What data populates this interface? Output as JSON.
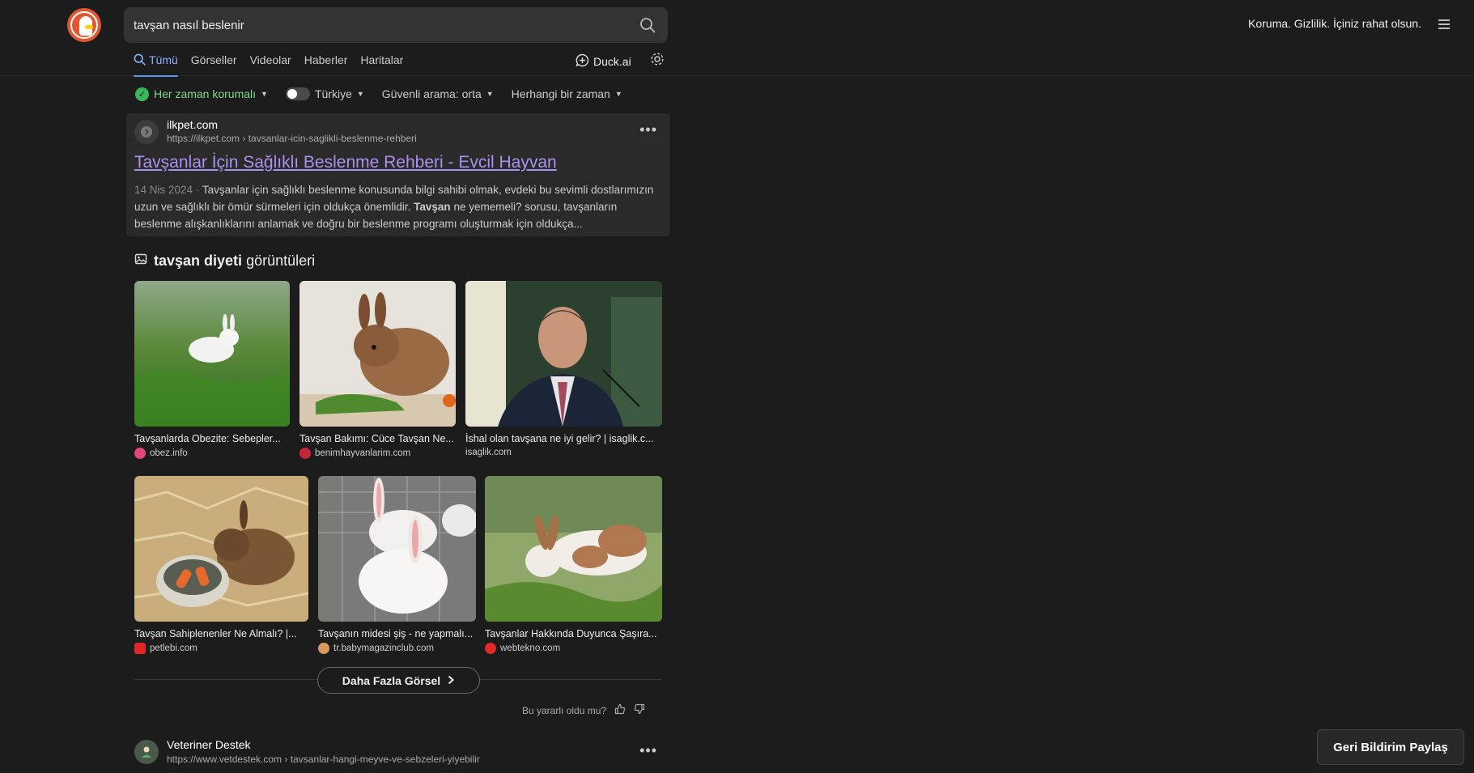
{
  "search": {
    "query": "tavşan nasıl beslenir"
  },
  "header": {
    "tagline": "Koruma. Gizlilik. İçiniz rahat olsun."
  },
  "tabs": [
    {
      "label": "Tümü",
      "active": true
    },
    {
      "label": "Görseller"
    },
    {
      "label": "Videolar"
    },
    {
      "label": "Haberler"
    },
    {
      "label": "Haritalar"
    }
  ],
  "duckai_label": "Duck.ai",
  "filters": {
    "protection": "Her zaman korumalı",
    "region": "Türkiye",
    "safe_search": "Güvenli arama: orta",
    "time": "Herhangi bir zaman"
  },
  "result1": {
    "site": "ilkpet.com",
    "url": "https://ilkpet.com › tavsanlar-icin-saglikli-beslenme-rehberi",
    "title": "Tavşanlar İçin Sağlıklı Beslenme Rehberi - Evcil Hayvan",
    "date": "14 Nis 2024",
    "snippet_1": "Tavşanlar için sağlıklı beslenme konusunda bilgi sahibi olmak, evdeki bu sevimli dostlarımızın uzun ve sağlıklı bir ömür sürmeleri için oldukça önemlidir.",
    "snippet_bold": "Tavşan",
    "snippet_2": "ne yememeli? sorusu, tavşanların beslenme alışkanlıklarını anlamak ve doğru bir beslenme programı oluşturmak için oldukça..."
  },
  "images_module": {
    "heading_bold": "tavşan diyeti",
    "heading_rest": "görüntüleri",
    "images": [
      {
        "caption": "Tavşanlarda Obezite: Sebepler...",
        "source": "obez.info",
        "source_color": "#e0457b"
      },
      {
        "caption": "Tavşan Bakımı: Cüce Tavşan Ne...",
        "source": "benimhayvanlarim.com",
        "source_color": "#c3283a"
      },
      {
        "caption": "İshal olan tavşana ne iyi gelir? | isaglik.c...",
        "source": "isaglik.com",
        "source_color": ""
      },
      {
        "caption": "Tavşan Sahiplenenler Ne Almalı? |...",
        "source": "petlebi.com",
        "source_color": "#e0262b"
      },
      {
        "caption": "Tavşanın midesi şiş - ne yapmalı...",
        "source": "tr.babymagazinclub.com",
        "source_color": "#d99a5a"
      },
      {
        "caption": "Tavşanlar Hakkında Duyunca Şaşıra...",
        "source": "webtekno.com",
        "source_color": "#e12a26"
      }
    ],
    "more_button": "Daha Fazla Görsel",
    "helpful_text": "Bu yararlı oldu mu?"
  },
  "result2": {
    "site": "Veteriner Destek",
    "url": "https://www.vetdestek.com › tavsanlar-hangi-meyve-ve-sebzeleri-yiyebilir"
  },
  "feedback_button": "Geri Bildirim Paylaş"
}
